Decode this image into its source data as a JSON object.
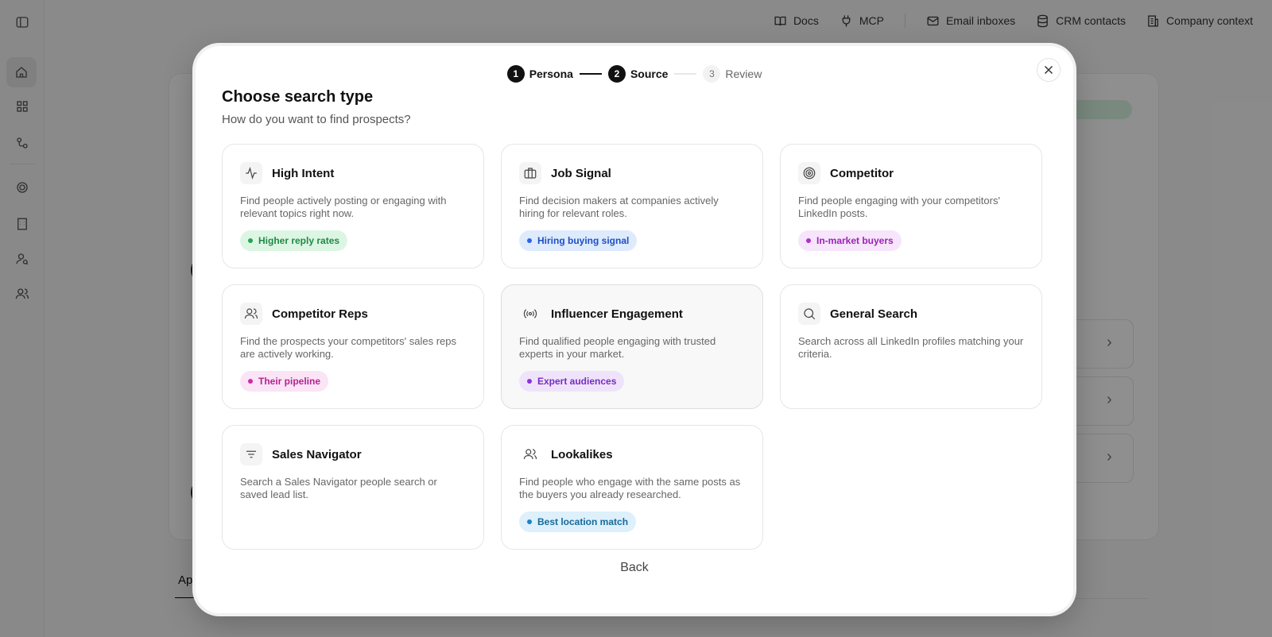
{
  "topnav": {
    "items": [
      {
        "label": "Docs",
        "icon": "book-icon"
      },
      {
        "label": "MCP",
        "icon": "plug-icon"
      },
      {
        "label": "Email inboxes",
        "icon": "mail-icon"
      },
      {
        "label": "CRM contacts",
        "icon": "database-icon"
      },
      {
        "label": "Company context",
        "icon": "building-icon"
      }
    ]
  },
  "background": {
    "bottom_tab_label": "App"
  },
  "modal": {
    "stepper": {
      "steps": [
        {
          "num": "1",
          "label": "Persona",
          "state": "done"
        },
        {
          "num": "2",
          "label": "Source",
          "state": "current"
        },
        {
          "num": "3",
          "label": "Review",
          "state": "todo"
        }
      ]
    },
    "title": "Choose search type",
    "subtitle": "How do you want to find prospects?",
    "cards": [
      {
        "title": "High Intent",
        "icon": "activity-icon",
        "desc": "Find people actively posting or engaging with relevant topics right now.",
        "tag": "Higher reply rates",
        "tag_bg": "#dcf6e3",
        "tag_fg": "#1f8a45",
        "tag_dot": "#22a653"
      },
      {
        "title": "Job Signal",
        "icon": "briefcase-icon",
        "desc": "Find decision makers at companies actively hiring for relevant roles.",
        "tag": "Hiring buying signal",
        "tag_bg": "#deebfd",
        "tag_fg": "#1f4fc4",
        "tag_dot": "#2c63e8"
      },
      {
        "title": "Competitor",
        "icon": "target-icon",
        "desc": "Find people engaging with your competitors' LinkedIn posts.",
        "tag": "In-market buyers",
        "tag_bg": "#f7e5fb",
        "tag_fg": "#9b23b5",
        "tag_dot": "#b22fd0"
      },
      {
        "title": "Competitor Reps",
        "icon": "users-icon",
        "desc": "Find the prospects your competitors' sales reps are actively working.",
        "tag": "Their pipeline",
        "tag_bg": "#fbe4f6",
        "tag_fg": "#b52294",
        "tag_dot": "#cf2aa9"
      },
      {
        "title": "Influencer Engagement",
        "icon": "broadcast-icon",
        "desc": "Find qualified people engaging with trusted experts in your market.",
        "tag": "Expert audiences",
        "tag_bg": "#efe3fb",
        "tag_fg": "#7a2cc0",
        "tag_dot": "#8b35d6"
      },
      {
        "title": "General Search",
        "icon": "search-icon",
        "desc": "Search across all LinkedIn profiles matching your criteria.",
        "tag": "",
        "tag_bg": "",
        "tag_fg": "",
        "tag_dot": ""
      },
      {
        "title": "Sales Navigator",
        "icon": "filter-icon",
        "desc": "Search a Sales Navigator people search or saved lead list.",
        "tag": "",
        "tag_bg": "",
        "tag_fg": "",
        "tag_dot": ""
      },
      {
        "title": "Lookalikes",
        "icon": "users-icon",
        "desc": "Find people who engage with the same posts as the buyers you already researched.",
        "tag": "Best location match",
        "tag_bg": "#ddf0fb",
        "tag_fg": "#16699b",
        "tag_dot": "#1b84c2"
      }
    ],
    "back_label": "Back"
  }
}
